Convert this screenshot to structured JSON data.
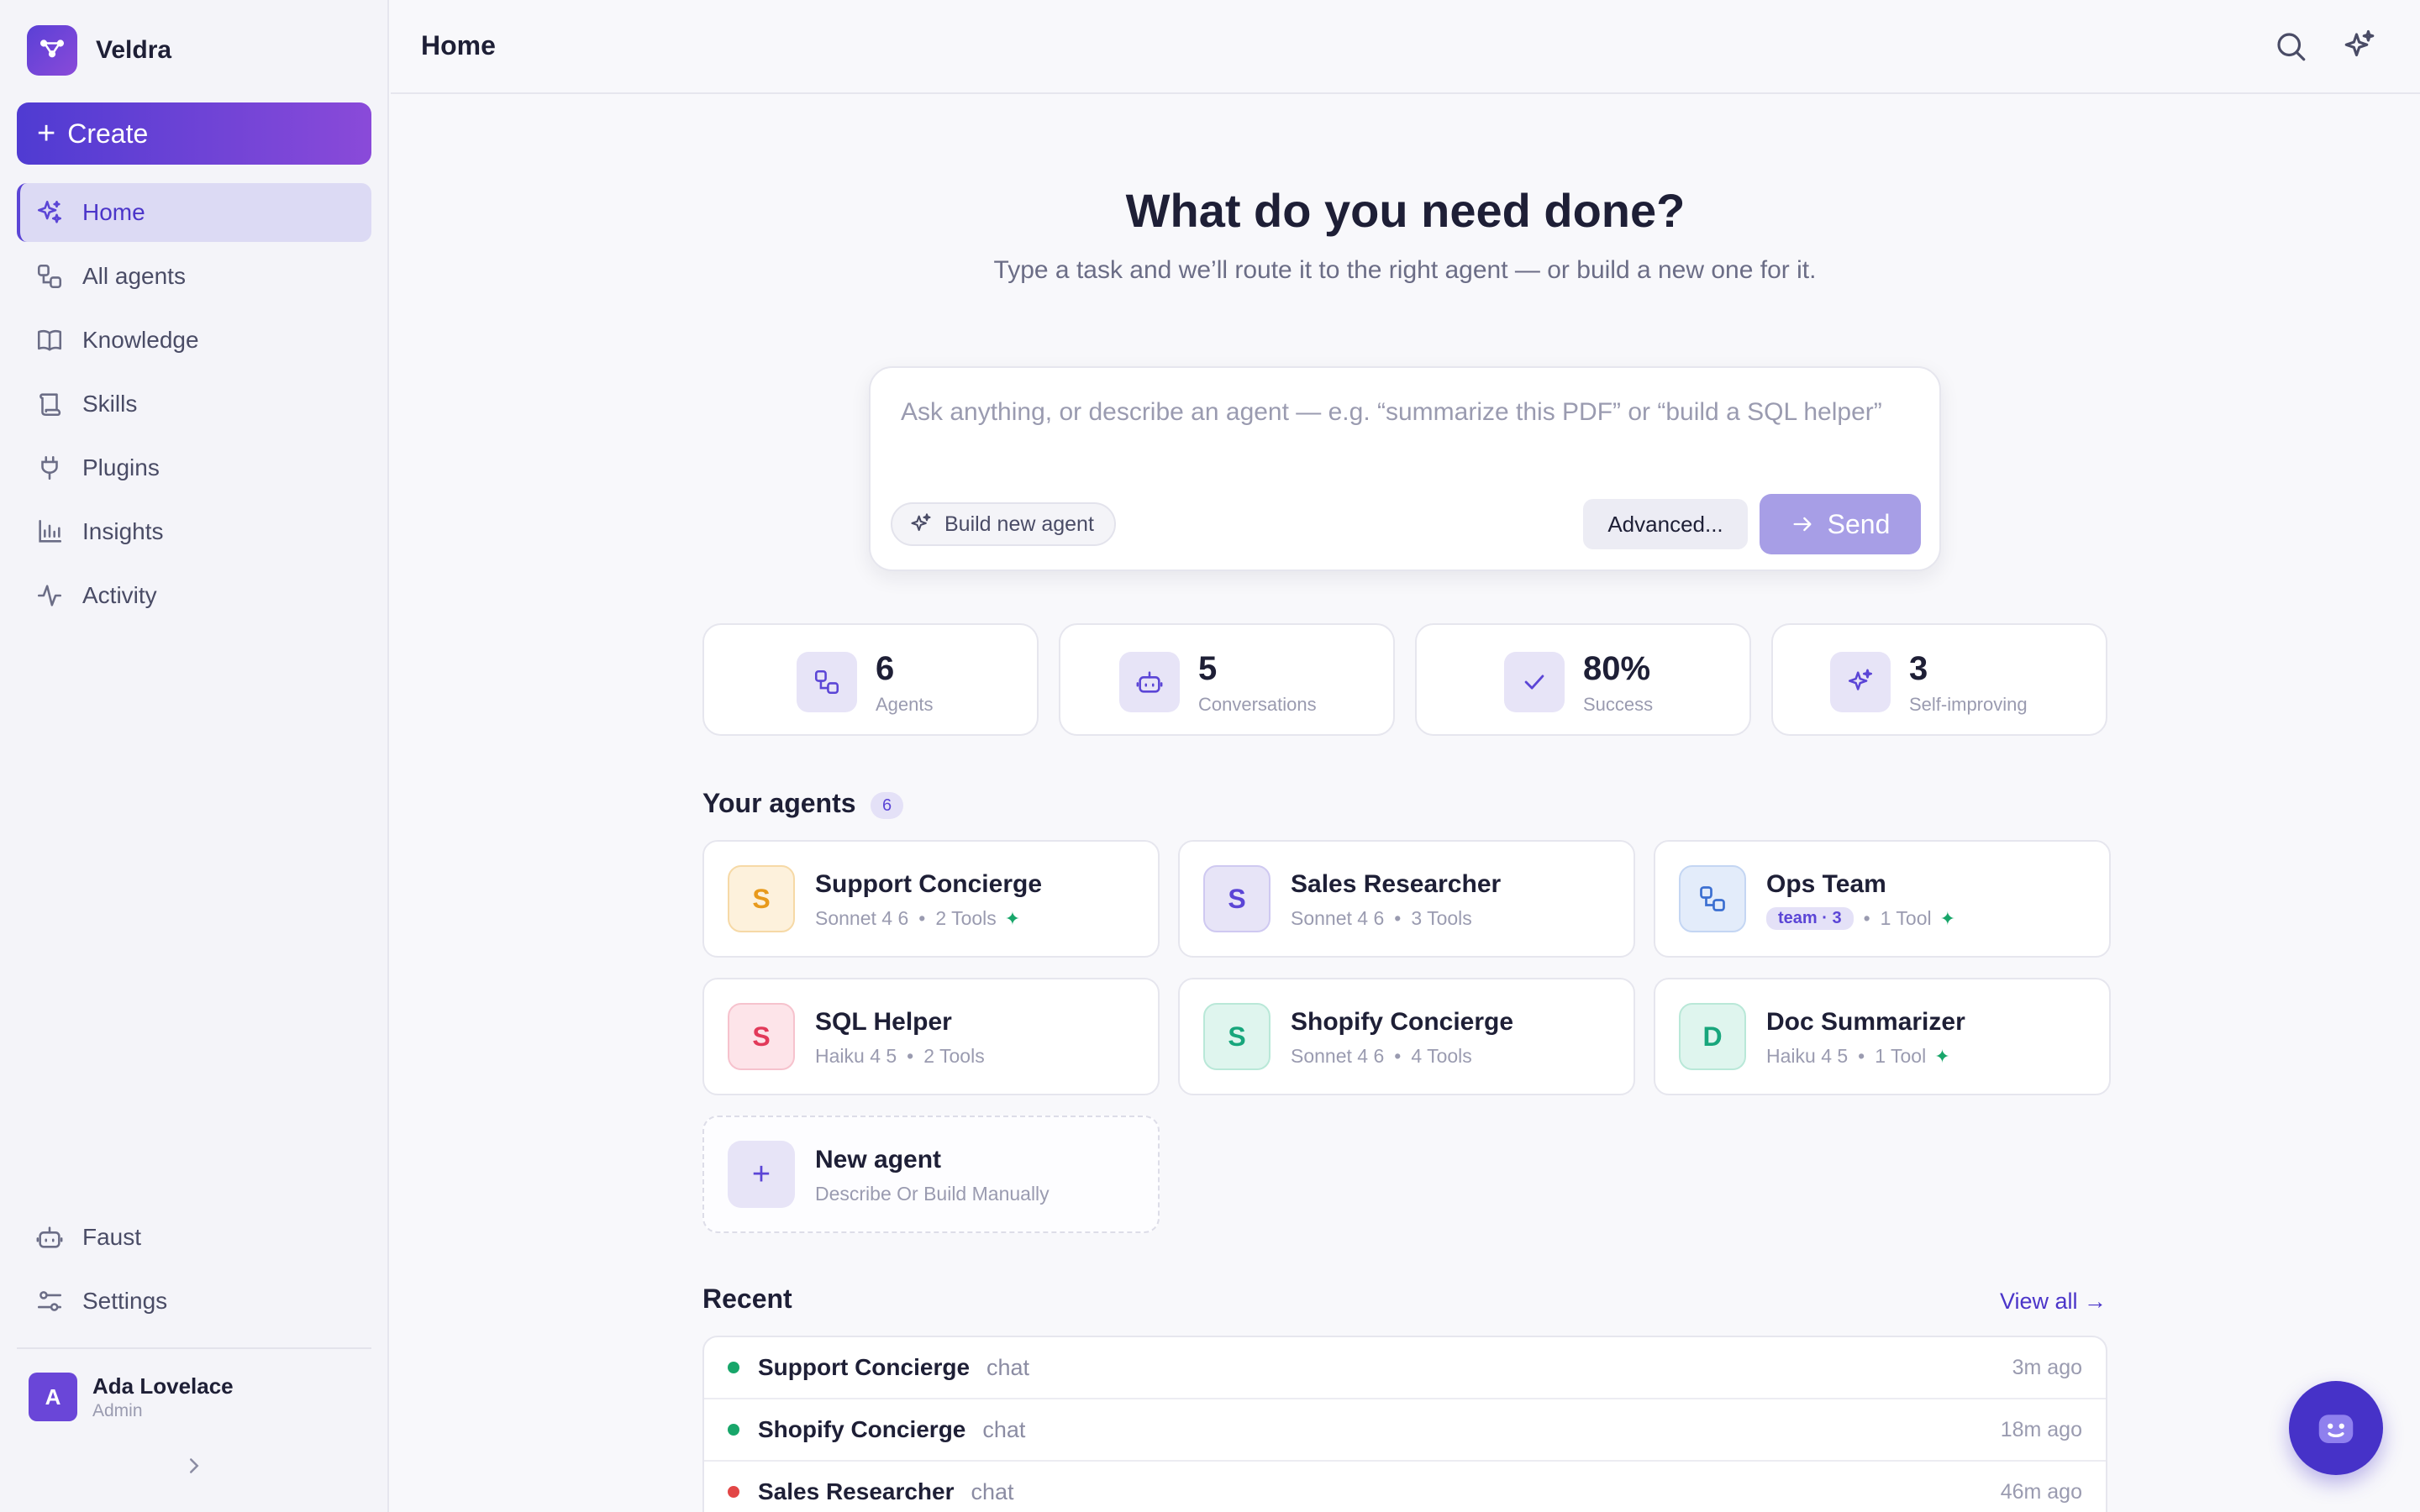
{
  "app": {
    "name": "Veldra"
  },
  "sidebar": {
    "create_label": "Create",
    "items": [
      {
        "label": "Home",
        "icon": "sparkles-icon",
        "active": true
      },
      {
        "label": "All agents",
        "icon": "agents-icon"
      },
      {
        "label": "Knowledge",
        "icon": "book-icon"
      },
      {
        "label": "Skills",
        "icon": "scroll-icon"
      },
      {
        "label": "Plugins",
        "icon": "plug-icon"
      },
      {
        "label": "Insights",
        "icon": "bar-chart-icon"
      },
      {
        "label": "Activity",
        "icon": "activity-icon"
      }
    ],
    "bottom_items": [
      {
        "label": "Faust",
        "icon": "bot-icon"
      },
      {
        "label": "Settings",
        "icon": "sliders-icon"
      }
    ],
    "user": {
      "initial": "A",
      "name": "Ada Lovelace",
      "role": "Admin"
    }
  },
  "header": {
    "title": "Home"
  },
  "hero": {
    "title": "What do you need done?",
    "subtitle": "Type a task and we’ll route it to the right agent — or build a new one for it."
  },
  "composer": {
    "placeholder": "Ask anything, or describe an agent — e.g. “summarize this PDF” or “build a SQL helper”",
    "build_label": "Build new agent",
    "advanced_label": "Advanced...",
    "send_label": "Send"
  },
  "stats": [
    {
      "value": "6",
      "label": "Agents",
      "icon": "agents-icon"
    },
    {
      "value": "5",
      "label": "Conversations",
      "icon": "bot-icon"
    },
    {
      "value": "80%",
      "label": "Success",
      "icon": "check-icon"
    },
    {
      "value": "3",
      "label": "Self-improving",
      "icon": "sparkles-icon"
    }
  ],
  "agents_section": {
    "title": "Your agents",
    "count": "6"
  },
  "agents": [
    {
      "initial": "S",
      "name": "Support Concierge",
      "model": "Sonnet 4 6",
      "tools": "2 Tools",
      "improving": true,
      "color": "#e89a1c",
      "bg": "#fdf1dc"
    },
    {
      "initial": "S",
      "name": "Sales Researcher",
      "model": "Sonnet 4 6",
      "tools": "3 Tools",
      "improving": false,
      "color": "#5b45d6",
      "bg": "#e7e4f7"
    },
    {
      "team": true,
      "name": "Ops Team",
      "team_label": "team · 3",
      "tools": "1 Tool",
      "improving": true,
      "color": "#3b6fd1",
      "bg": "#e3ecfa"
    },
    {
      "initial": "S",
      "name": "SQL Helper",
      "model": "Haiku 4 5",
      "tools": "2 Tools",
      "improving": false,
      "color": "#e23a5a",
      "bg": "#fde4e9"
    },
    {
      "initial": "S",
      "name": "Shopify Concierge",
      "model": "Sonnet 4 6",
      "tools": "4 Tools",
      "improving": false,
      "color": "#18a67c",
      "bg": "#dff5ee"
    },
    {
      "initial": "D",
      "name": "Doc Summarizer",
      "model": "Haiku 4 5",
      "tools": "1 Tool",
      "improving": true,
      "color": "#18a67c",
      "bg": "#dff5ee"
    }
  ],
  "new_agent": {
    "title": "New agent",
    "subtitle": "Describe Or Build Manually"
  },
  "recent": {
    "title": "Recent",
    "view_all": "View all →",
    "items": [
      {
        "name": "Support Concierge",
        "kind": "chat",
        "time": "3m ago",
        "status_color": "#18a66a"
      },
      {
        "name": "Shopify Concierge",
        "kind": "chat",
        "time": "18m ago",
        "status_color": "#18a66a"
      },
      {
        "name": "Sales Researcher",
        "kind": "chat",
        "time": "46m ago",
        "status_color": "#e24646"
      }
    ]
  },
  "colors": {
    "accent": "#5b45d6",
    "success": "#18a66a",
    "error": "#e24646"
  }
}
